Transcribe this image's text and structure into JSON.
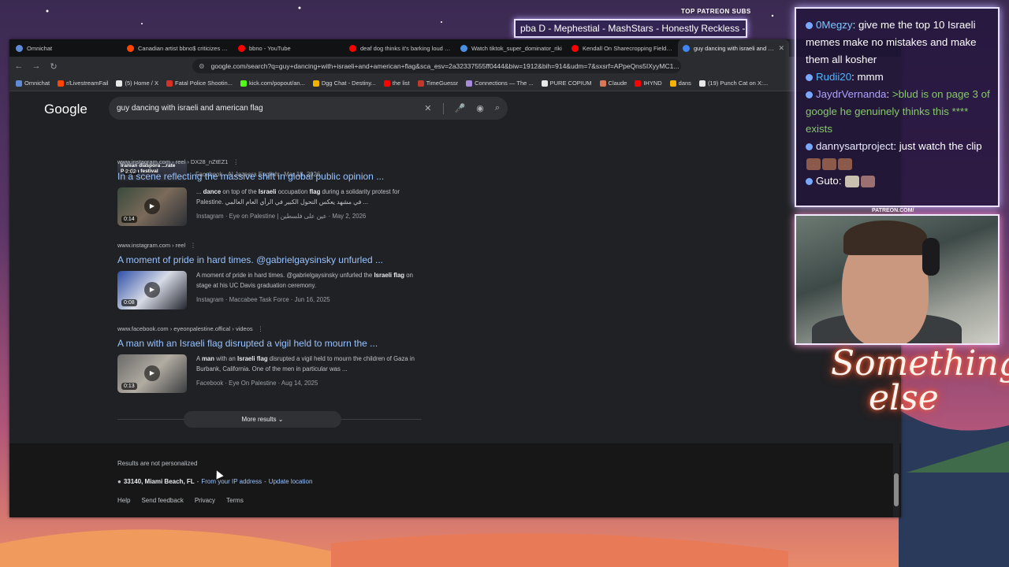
{
  "overlay": {
    "patreon_label": "TOP PATREON SUBS",
    "ticker_text": "pba D - Mephestial - MashStars - Honestly Reckless - Mo",
    "cam_label": "PATREON.COM/",
    "neon_line1": "Something",
    "neon_line2": "else",
    "colors": {
      "chat_border": "#e9e2ff",
      "neon": "#ff6a3c",
      "ticker_bg": "#281e50"
    }
  },
  "tabs": [
    {
      "label": "Omnichat",
      "icon": "omnichat-icon",
      "color": "#5f8bd6"
    },
    {
      "label": "Canadian artist bbno$ criticizes a \"c",
      "icon": "reddit-icon",
      "color": "#ff4500"
    },
    {
      "label": "bbno - YouTube",
      "icon": "youtube-icon",
      "color": "#ff0000"
    },
    {
      "label": "deaf dog thinks it's barking loud - Y",
      "icon": "youtube-icon",
      "color": "#ff0000"
    },
    {
      "label": "Watch tiktok_super_dominator_riki",
      "icon": "watch-icon",
      "color": "#4a90e2"
    },
    {
      "label": "Kendall On Sharecropping Field Trip",
      "icon": "youtube-icon",
      "color": "#ff0000"
    },
    {
      "label": "guy dancing with israeli and am",
      "icon": "google-icon",
      "color": "#4285f4"
    }
  ],
  "address_bar": {
    "url": "google.com/search?q=guy+dancing+with+israeli+and+american+flag&sca_esv=2a32337555ff0444&biw=1912&bih=914&udm=7&sxsrf=APpeQns5IXyyMC1..."
  },
  "bookmarks": [
    {
      "label": "Omnichat",
      "color": "#5f8bd6"
    },
    {
      "label": "r/LivestreamFail",
      "color": "#ff4500"
    },
    {
      "label": "(5) Home / X",
      "color": "#e8e8e8"
    },
    {
      "label": "Fatal Police Shootin...",
      "color": "#d93025"
    },
    {
      "label": "kick.com/popout/an...",
      "color": "#53fc18"
    },
    {
      "label": "Dgg Chat - Destiny...",
      "color": "#f0b400"
    },
    {
      "label": "the list",
      "color": "#ff0000"
    },
    {
      "label": "TimeGuessr",
      "color": "#c0392b"
    },
    {
      "label": "Connections — The ...",
      "color": "#a58bd8"
    },
    {
      "label": "PURE COPIUM",
      "color": "#e8e8e8"
    },
    {
      "label": "Claude",
      "color": "#d97757"
    },
    {
      "label": "IHYND",
      "color": "#ff0000"
    },
    {
      "label": "dans",
      "color": "#f4b400"
    },
    {
      "label": "(19) Punch Cat on X:...",
      "color": "#e8e8e8"
    }
  ],
  "google": {
    "logo": "Google",
    "query": "guy dancing with israeli and american flag"
  },
  "first_result_meta": "Facebook · Al Jazeera English · Mar 18, 2026",
  "first_thumb_duration": "2:02",
  "first_thumb_caption": "Iranian diaspora ...rate Persian festival",
  "results": [
    {
      "site": "www.instagram.com › reel › DX28_nZtEZ1",
      "title": "In a scene reflecting the massive shift in global public opinion ...",
      "snippet_pre": "... ",
      "snippet_b1": "dance",
      "snippet_mid1": " on top of the ",
      "snippet_b2": "Israeli",
      "snippet_mid2": " occupation ",
      "snippet_b3": "flag",
      "snippet_post": " during a solidarity protest for Palestine. في مشهد يعكس التحول الكبير في الرأي العام العالمي ...",
      "meta": "Instagram · Eye on Palestine | عين على فلسطين · May 2, 2026",
      "duration": "0:14"
    },
    {
      "site": "www.instagram.com › reel",
      "title": "A moment of pride in hard times. @gabrielgaysinsky unfurled ...",
      "snippet_pre": "A moment of pride in hard times. @gabrielgaysinsky unfurled the ",
      "snippet_b1": "Israeli flag",
      "snippet_mid1": " on stage at his UC Davis graduation ceremony.",
      "snippet_b2": "",
      "snippet_mid2": "",
      "snippet_b3": "",
      "snippet_post": "",
      "meta": "Instagram · Maccabee Task Force · Jun 16, 2025",
      "duration": "0:08"
    },
    {
      "site": "www.facebook.com › eyeonpalestine.offical › videos",
      "title": "A man with an Israeli flag disrupted a vigil held to mourn the ...",
      "snippet_pre": "A ",
      "snippet_b1": "man",
      "snippet_mid1": " with an ",
      "snippet_b2": "Israeli flag",
      "snippet_mid2": " disrupted a vigil held to mourn the children of Gaza in Burbank, California. One of the men in particular was ...",
      "snippet_b3": "",
      "snippet_post": "",
      "meta": "Facebook · Eye On Palestine · Aug 14, 2025",
      "duration": "0:13"
    }
  ],
  "more_results": "More results",
  "footer": {
    "not_personalized": "Results are not personalized",
    "location": "33140, Miami Beach, FL",
    "from_ip": "From your IP address",
    "update_location": "Update location",
    "links": [
      "Help",
      "Send feedback",
      "Privacy",
      "Terms"
    ]
  },
  "chat": [
    {
      "user": "0Megzy",
      "text": "give me the top 10 Israeli memes make no mistakes and make them all kosher",
      "style": "u1"
    },
    {
      "user": "Rudii20",
      "text": "mmm",
      "style": "u2"
    },
    {
      "user": "JaydrVernanda",
      "text": ">blud is on page 3 of google he genuinely thinks this **** exists",
      "style": "u3"
    },
    {
      "user": "dannysartproject",
      "text": "just watch the clip",
      "style": "u4"
    },
    {
      "user": "Guto",
      "text": "",
      "style": "u5"
    }
  ]
}
